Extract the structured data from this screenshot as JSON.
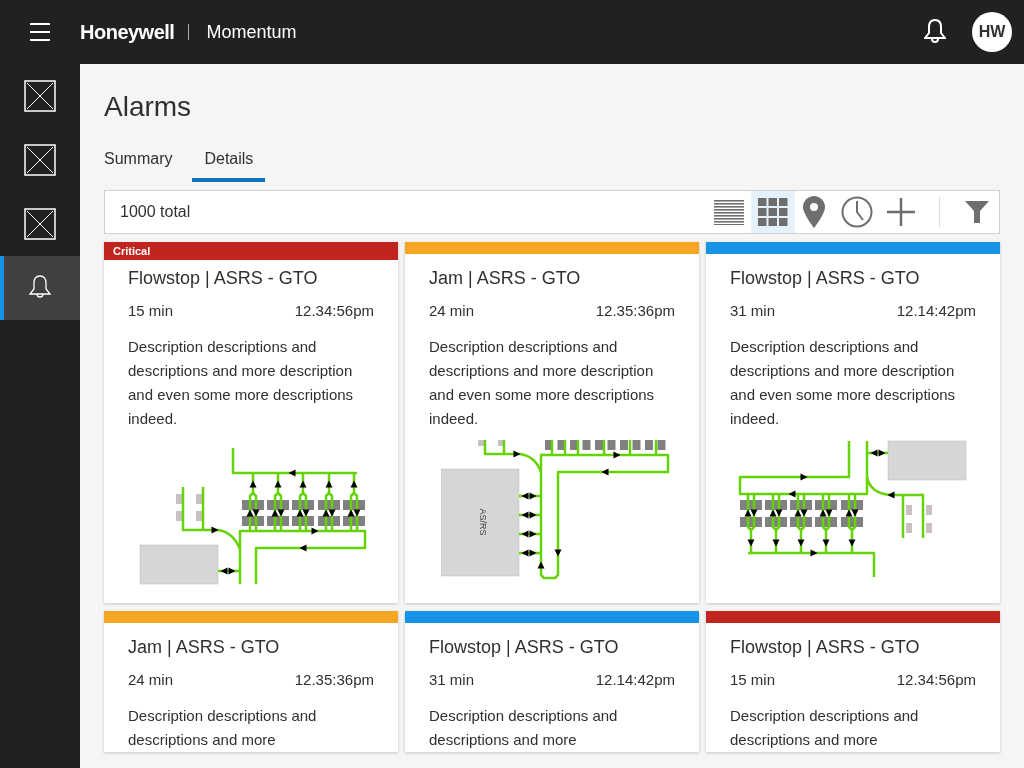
{
  "header": {
    "brand": "Honeywell",
    "product": "Momentum",
    "avatar": "HW"
  },
  "sidebar": {
    "items": [
      {
        "kind": "placeholder",
        "selected": false
      },
      {
        "kind": "placeholder",
        "selected": false
      },
      {
        "kind": "placeholder",
        "selected": false
      },
      {
        "kind": "alarms",
        "selected": true
      }
    ]
  },
  "page": {
    "title": "Alarms"
  },
  "tabs": [
    {
      "label": "Summary",
      "selected": false
    },
    {
      "label": "Details",
      "selected": true
    }
  ],
  "toolbar": {
    "count": "1000 total",
    "views": [
      {
        "kind": "list",
        "selected": false
      },
      {
        "kind": "grid",
        "selected": true
      }
    ]
  },
  "cards": [
    {
      "color": "#c0251f",
      "badge": "Critical",
      "title": "Flowstop | ASRS - GTO",
      "duration": "15 min",
      "time": "12.34:56pm",
      "description": "Description descriptions and descriptions and more description and even some more descriptions indeed.",
      "diagram": {
        "kind": "a"
      }
    },
    {
      "color": "#f5a623",
      "title": "Jam | ASRS - GTO",
      "duration": "24 min",
      "time": "12.35:36pm",
      "description": "Description descriptions and descriptions and more description and even some more descriptions indeed.",
      "diagram": {
        "kind": "b",
        "label": "AS/RS"
      }
    },
    {
      "color": "#1792e5",
      "title": "Flowstop | ASRS - GTO",
      "duration": "31 min",
      "time": "12.14:42pm",
      "description": "Description descriptions and descriptions and more description and even some more descriptions indeed.",
      "diagram": {
        "kind": "c"
      }
    },
    {
      "color": "#f5a623",
      "title": "Jam | ASRS - GTO",
      "duration": "24 min",
      "time": "12.35:36pm",
      "description": "Description descriptions and descriptions and more"
    },
    {
      "color": "#1792e5",
      "title": "Flowstop | ASRS - GTO",
      "duration": "31 min",
      "time": "12.14:42pm",
      "description": "Description descriptions and descriptions and more"
    },
    {
      "color": "#c0251f",
      "title": "Flowstop | ASRS - GTO",
      "duration": "15 min",
      "time": "12.34:56pm",
      "description": "Description descriptions and descriptions and more"
    }
  ]
}
